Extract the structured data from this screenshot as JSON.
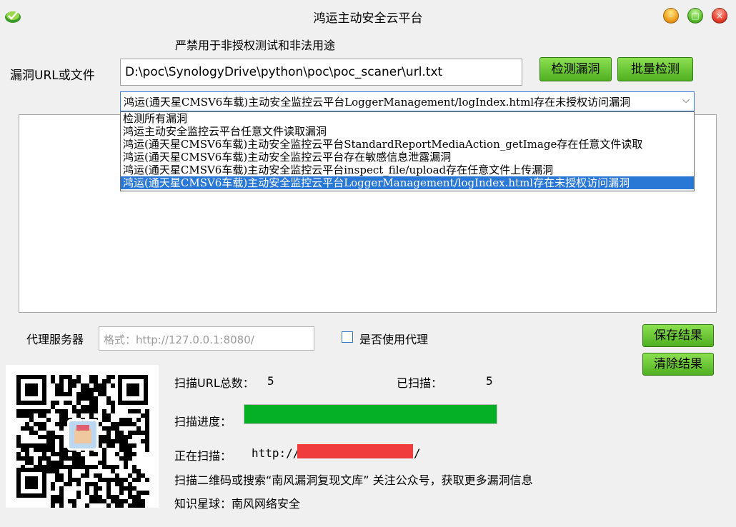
{
  "window": {
    "title": "鸿运主动安全云平台"
  },
  "warning": "严禁用于非授权测试和非法用途",
  "target": {
    "label": "漏洞URL或文件",
    "value": "D:\\poc\\SynologyDrive\\python\\poc\\poc_scaner\\url.txt"
  },
  "buttons": {
    "check": "检测漏洞",
    "batch": "批量检测",
    "save": "保存结果",
    "clear": "清除结果"
  },
  "vuln_select": {
    "selected": "鸿运(通天星CMSV6车载)主动安全监控云平台LoggerManagement/logIndex.html存在未授权访问漏洞",
    "options": [
      "检测所有漏洞",
      "鸿运主动安全监控云平台任意文件读取漏洞",
      "鸿运(通天星CMSV6车载)主动安全监控云平台StandardReportMediaAction_getImage存在任意文件读取",
      "鸿运(通天星CMSV6车载)主动安全监控云平台存在敏感信息泄露漏洞",
      "鸿运(通天星CMSV6车载)主动安全监控云平台inspect_file/upload存在任意文件上传漏洞",
      "鸿运(通天星CMSV6车载)主动安全监控云平台LoggerManagement/logIndex.html存在未授权访问漏洞"
    ],
    "highlighted_index": 5
  },
  "proxy": {
    "label": "代理服务器",
    "placeholder": "格式：http://127.0.0.1:8080/",
    "use_label": "是否使用代理",
    "use_checked": false
  },
  "stats": {
    "total_label": "扫描URL总数：",
    "total_value": "5",
    "scanned_label": "已扫描：",
    "scanned_value": "5",
    "progress_label": "扫描进度：",
    "progress_percent": 100,
    "current_label": "正在扫描：",
    "current_prefix": "http://",
    "current_suffix": "/"
  },
  "footer": {
    "promo": "扫描二维码或搜索“南风漏洞复现文库”  关注公众号，获取更多漏洞信息",
    "planet": "知识星球：南风网络安全"
  },
  "colors": {
    "button_green": "#5cc030",
    "progress_green": "#06b025",
    "selection_blue": "#2a78d6",
    "redaction_red": "#f03c3c"
  }
}
